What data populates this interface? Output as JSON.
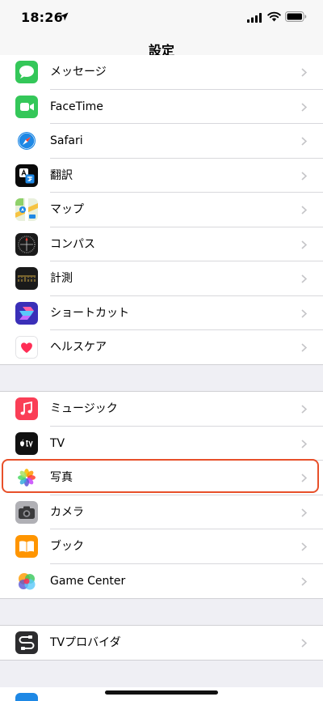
{
  "status": {
    "time": "18:26"
  },
  "nav": {
    "title": "設定"
  },
  "groups": [
    [
      {
        "label": "メッセージ",
        "icon": "messages-icon",
        "color": "#34c759"
      },
      {
        "label": "FaceTime",
        "icon": "facetime-icon",
        "color": "#34c759"
      },
      {
        "label": "Safari",
        "icon": "safari-icon",
        "color": "#1e88e5"
      },
      {
        "label": "翻訳",
        "icon": "translate-icon",
        "color": "#0a0a0a"
      },
      {
        "label": "マップ",
        "icon": "maps-icon",
        "color": "#8fd16a"
      },
      {
        "label": "コンパス",
        "icon": "compass-icon",
        "color": "#1a1a1a"
      },
      {
        "label": "計測",
        "icon": "measure-icon",
        "color": "#1a1a1a"
      },
      {
        "label": "ショートカット",
        "icon": "shortcuts-icon",
        "color": "#4a3bd1"
      },
      {
        "label": "ヘルスケア",
        "icon": "health-icon",
        "color": "#ffffff"
      }
    ],
    [
      {
        "label": "ミュージック",
        "icon": "music-icon",
        "color": "#fa3e56"
      },
      {
        "label": "TV",
        "icon": "tv-icon",
        "color": "#111111"
      },
      {
        "label": "写真",
        "icon": "photos-icon",
        "color": "#ffffff"
      },
      {
        "label": "カメラ",
        "icon": "camera-icon",
        "color": "#8e8e93"
      },
      {
        "label": "ブック",
        "icon": "books-icon",
        "color": "#ff9500"
      },
      {
        "label": "Game Center",
        "icon": "game-center-icon",
        "color": "#ffffff"
      }
    ],
    [
      {
        "label": "TVプロバイダ",
        "icon": "tv-provider-icon",
        "color": "#2c2c2e"
      }
    ]
  ],
  "highlight_color": "#e8502a"
}
